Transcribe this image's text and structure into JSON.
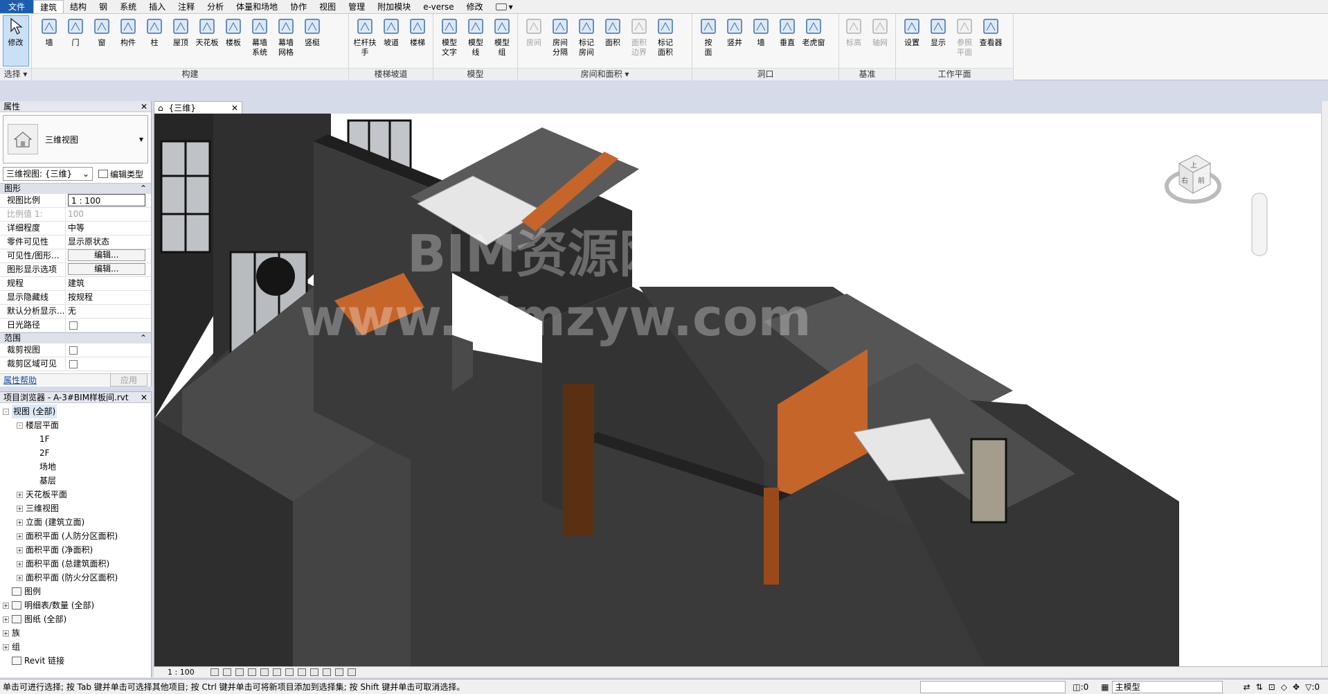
{
  "menu": {
    "tabs": [
      "文件",
      "建筑",
      "结构",
      "钢",
      "系统",
      "插入",
      "注释",
      "分析",
      "体量和场地",
      "协作",
      "视图",
      "管理",
      "附加模块",
      "e-verse",
      "修改"
    ]
  },
  "ribbon": {
    "select_panel": {
      "tool": "修改",
      "title": "选择"
    },
    "build_panel": {
      "title": "构建",
      "tools": [
        "墙",
        "门",
        "窗",
        "构件",
        "柱",
        "屋顶",
        "天花板",
        "楼板",
        "幕墙\n系统",
        "幕墙\n网格",
        "竖梃"
      ]
    },
    "stairs_panel": {
      "title": "楼梯坡道",
      "tools": [
        "栏杆扶手",
        "坡道",
        "楼梯"
      ]
    },
    "model_panel": {
      "title": "模型",
      "tools": [
        "模型\n文字",
        "模型\n线",
        "模型\n组"
      ]
    },
    "room_panel": {
      "title": "房间和面积",
      "tools": [
        "房间",
        "房间\n分隔",
        "标记\n房间",
        "面积",
        "面积\n边界",
        "标记\n面积"
      ]
    },
    "opening_panel": {
      "title": "洞口",
      "tools": [
        "按\n面",
        "竖井",
        "墙",
        "垂直",
        "老虎窗"
      ]
    },
    "datum_panel": {
      "title": "基准",
      "tools": [
        "标高",
        "轴网"
      ]
    },
    "workplane_panel": {
      "title": "工作平面",
      "tools": [
        "设置",
        "显示",
        "参照\n平面",
        "查看器"
      ]
    }
  },
  "properties": {
    "title": "属性",
    "type_name": "三维视图",
    "view_selector": "三维视图: {三维}",
    "edit_type": "编辑类型",
    "groups": [
      {
        "name": "图形",
        "rows": [
          {
            "key": "视图比例",
            "value": "1 : 100",
            "kind": "input"
          },
          {
            "key": "比例值 1:",
            "value": "100",
            "kind": "dim"
          },
          {
            "key": "详细程度",
            "value": "中等",
            "kind": "text"
          },
          {
            "key": "零件可见性",
            "value": "显示原状态",
            "kind": "text"
          },
          {
            "key": "可见性/图形...",
            "value": "编辑...",
            "kind": "button"
          },
          {
            "key": "图形显示选项",
            "value": "编辑...",
            "kind": "button"
          },
          {
            "key": "规程",
            "value": "建筑",
            "kind": "text"
          },
          {
            "key": "显示隐藏线",
            "value": "按规程",
            "kind": "text"
          },
          {
            "key": "默认分析显示...",
            "value": "无",
            "kind": "text"
          },
          {
            "key": "日光路径",
            "value": "",
            "kind": "check"
          }
        ]
      },
      {
        "name": "范围",
        "rows": [
          {
            "key": "裁剪视图",
            "value": "",
            "kind": "check"
          },
          {
            "key": "裁剪区域可见",
            "value": "",
            "kind": "check"
          }
        ]
      }
    ],
    "help_link": "属性帮助",
    "apply": "应用"
  },
  "browser": {
    "title": "项目浏览器 - A-3#BIM样板间.rvt",
    "nodes": [
      {
        "label": "视图 (全部)",
        "level": 0,
        "toggle": "-",
        "selected": true
      },
      {
        "label": "楼层平面",
        "level": 1,
        "toggle": "-"
      },
      {
        "label": "1F",
        "level": 2
      },
      {
        "label": "2F",
        "level": 2
      },
      {
        "label": "场地",
        "level": 2
      },
      {
        "label": "基层",
        "level": 2
      },
      {
        "label": "天花板平面",
        "level": 1,
        "toggle": "+"
      },
      {
        "label": "三维视图",
        "level": 1,
        "toggle": "+"
      },
      {
        "label": "立面 (建筑立面)",
        "level": 1,
        "toggle": "+"
      },
      {
        "label": "面积平面 (人防分区面积)",
        "level": 1,
        "toggle": "+"
      },
      {
        "label": "面积平面 (净面积)",
        "level": 1,
        "toggle": "+"
      },
      {
        "label": "面积平面 (总建筑面积)",
        "level": 1,
        "toggle": "+"
      },
      {
        "label": "面积平面 (防火分区面积)",
        "level": 1,
        "toggle": "+"
      },
      {
        "label": "图例",
        "level": 0,
        "icon": true
      },
      {
        "label": "明细表/数量 (全部)",
        "level": 0,
        "toggle": "+",
        "icon": true
      },
      {
        "label": "图纸 (全部)",
        "level": 0,
        "toggle": "+",
        "icon": true
      },
      {
        "label": "族",
        "level": 0,
        "toggle": "+"
      },
      {
        "label": "组",
        "level": 0,
        "toggle": "+"
      },
      {
        "label": "Revit 链接",
        "level": 0,
        "icon": true
      }
    ]
  },
  "view": {
    "tab_label": "{三维}",
    "watermark_cn": "BIM资源网",
    "watermark_url": "www.bimzyw.com",
    "viewcube_labels": [
      "上",
      "右",
      "前"
    ],
    "scale": "1 : 100"
  },
  "status": {
    "message": "单击可进行选择; 按 Tab 键并单击可选择其他项目; 按 Ctrl 键并单击可将新项目添加到选择集; 按 Shift 键并单击可取消选择。",
    "count": ":0",
    "model": "主模型",
    "filter_count": ":0"
  },
  "colors": {
    "file_tab": "#1d5dad",
    "wall": "#3d3d3d",
    "wall_top": "#2a2a2a",
    "wood": "#c6652a"
  }
}
